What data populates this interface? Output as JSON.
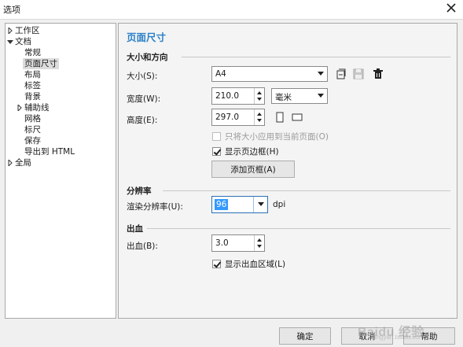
{
  "window": {
    "title": "选项"
  },
  "tree": {
    "items": [
      {
        "label": "工作区",
        "expander": "collapsed"
      },
      {
        "label": "文档",
        "expander": "expanded"
      },
      {
        "label": "常规"
      },
      {
        "label": "页面尺寸",
        "selected": true
      },
      {
        "label": "布局"
      },
      {
        "label": "标签"
      },
      {
        "label": "背景"
      },
      {
        "label": "辅助线",
        "expander": "collapsed"
      },
      {
        "label": "网格"
      },
      {
        "label": "标尺"
      },
      {
        "label": "保存"
      },
      {
        "label": "导出到 HTML"
      },
      {
        "label": "全局",
        "expander": "collapsed"
      }
    ]
  },
  "panel": {
    "title": "页面尺寸",
    "size_section": {
      "heading": "大小和方向",
      "size_label": "大小(S):",
      "size_value": "A4",
      "width_label": "宽度(W):",
      "width_value": "210.0",
      "unit_value": "毫米",
      "height_label": "高度(E):",
      "height_value": "297.0",
      "apply_current_page_only": "只将大小应用到当前页面(O)",
      "show_page_border": "显示页边框(H)",
      "add_page_frame_button": "添加页框(A)"
    },
    "resolution_section": {
      "heading": "分辨率",
      "render_label": "渲染分辨率(U):",
      "render_value": "96",
      "unit": "dpi"
    },
    "bleed_section": {
      "heading": "出血",
      "bleed_label": "出血(B):",
      "bleed_value": "3.0",
      "show_bleed_area": "显示出血区域(L)"
    }
  },
  "footer": {
    "ok": "确定",
    "cancel": "取消",
    "help": "帮助"
  },
  "watermark": {
    "text": "Baidu 经验",
    "sub": "jingyan.baidu.com"
  },
  "colors": {
    "accent": "#2b80c8",
    "selection": "#3399ff"
  },
  "icons": [
    "close-icon",
    "save-preset-icon",
    "save-icon",
    "delete-icon",
    "portrait-icon",
    "landscape-icon"
  ]
}
